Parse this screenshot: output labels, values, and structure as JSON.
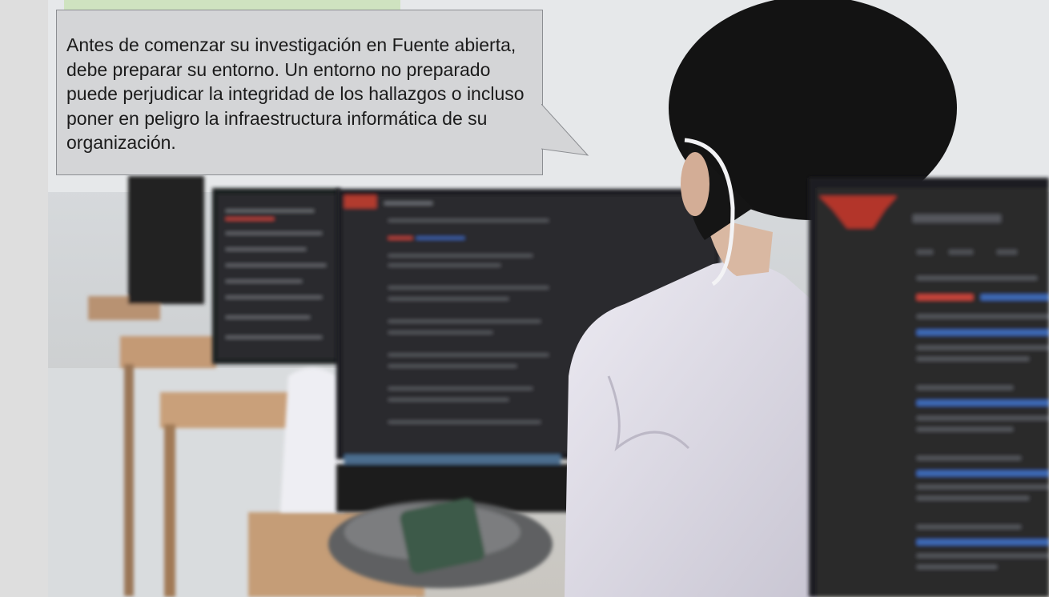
{
  "slide": {
    "callout_text": "Antes de comenzar su investigación en Fuente abierta, debe preparar su entorno. Un entorno no preparado puede perjudicar la integridad de los hallazgos o incluso poner en peligro la infraestructura informática de su organización."
  },
  "photo": {
    "subject": "person-at-computer-lab-icon"
  },
  "colors": {
    "callout_background": "#d4d5d7",
    "callout_border": "#8c8e92",
    "callout_text": "#1b1b1b",
    "monitor_screen": "#2b2c2f"
  }
}
